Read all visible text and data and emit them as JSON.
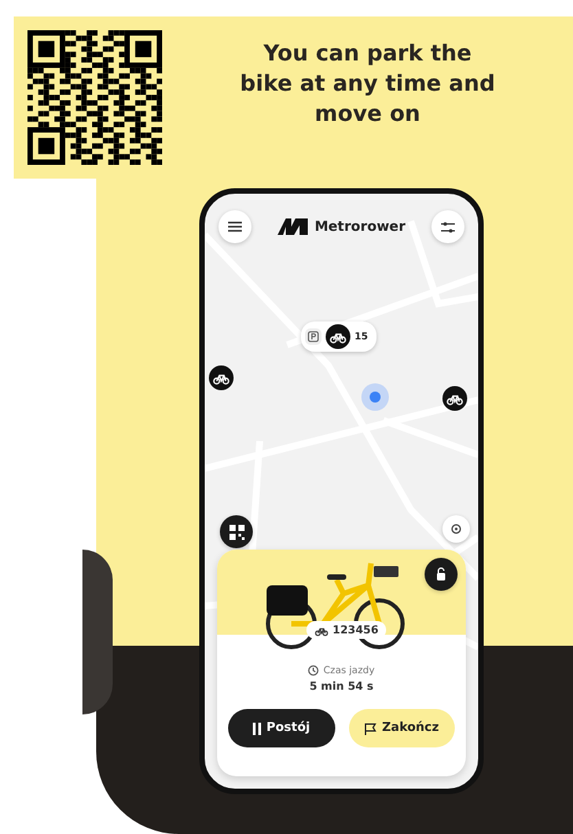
{
  "headline": "You can park the bike at any time and move on",
  "app": {
    "brand": "Metrorower",
    "map_pins": [
      {
        "kind": "station",
        "count": "15"
      },
      {
        "kind": "bike"
      },
      {
        "kind": "bike"
      },
      {
        "kind": "location"
      }
    ],
    "ride": {
      "bike_number": "123456",
      "time_label": "Czas jazdy",
      "time_value": "5 min 54 s",
      "buttons": [
        {
          "label": "Postój",
          "kind": "pause"
        },
        {
          "label": "Zakończ",
          "kind": "finish"
        }
      ]
    }
  }
}
